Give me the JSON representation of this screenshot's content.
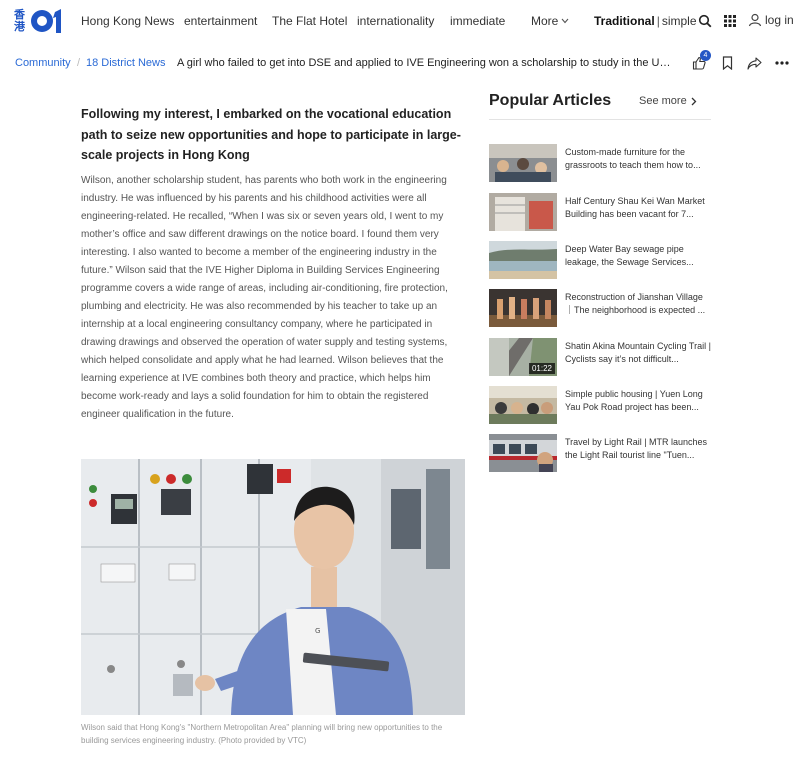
{
  "brand": {
    "cjk_line1": "香",
    "cjk_line2": "港",
    "accent": "#1f55c4"
  },
  "nav": {
    "items": [
      "Hong Kong News",
      "entertainment",
      "The Flat Hotel",
      "internationality",
      "immediate"
    ],
    "more_label": "More",
    "lang_active": "Traditional",
    "lang_sep": "|",
    "lang_alt": "simple",
    "login_label": "log in",
    "icons": [
      "search-icon",
      "grid-icon",
      "user-icon",
      "chevron-down-icon"
    ]
  },
  "breadcrumb": {
    "items": [
      "Community",
      "18 District News"
    ],
    "separator": "/",
    "headline": "A girl who failed to get into DSE and applied to IVE Engineering won a scholarship to study in the UK:...",
    "like_count": "4",
    "icons": [
      "like-icon",
      "bookmark-icon",
      "share-icon",
      "more-icon"
    ]
  },
  "article": {
    "subheading": "Following my interest, I embarked on the vocational education path to seize new opportunities and hope to participate in large-scale projects in Hong Kong",
    "body": "Wilson, another scholarship student, has parents who both work in the engineering industry. He was influenced by his parents and his childhood activities were all engineering-related. He recalled, “When I was six or seven years old, I went to my mother’s office and saw different drawings on the notice board. I found them very interesting. I also wanted to become a member of the engineering industry in the future.” Wilson said that the IVE Higher Diploma in Building Services Engineering programme covers a wide range of areas, including air-conditioning, fire protection, plumbing and electricity. He was also recommended by his teacher to take up an internship at a local engineering consultancy company, where he participated in drawing drawings and observed the operation of water supply and testing systems, which helped consolidate and apply what he had learned. Wilson believes that the learning experience at IVE combines both theory and practice, which helps him become work-ready and lays a solid foundation for him to obtain the registered engineer qualification in the future.",
    "photo_caption": "Wilson said that Hong Kong's \"Northern Metropolitan Area\" planning will bring new opportunities to the building services engineering industry. (Photo provided by VTC)"
  },
  "popular": {
    "title": "Popular Articles",
    "see_more": "See more",
    "items": [
      {
        "text": "Custom-made furniture for the grassroots to teach them how to..."
      },
      {
        "text": "Half Century Shau Kei Wan Market Building has been vacant for 7..."
      },
      {
        "text": "Deep Water Bay sewage pipe leakage, the Sewage Services..."
      },
      {
        "text": "Reconstruction of Jianshan Village ｜The neighborhood is expected ..."
      },
      {
        "text": "Shatin Akina Mountain Cycling Trail | Cyclists say it’s not difficult...",
        "duration": "01:22"
      },
      {
        "text": "Simple public housing | Yuen Long Yau Pok Road project has been..."
      },
      {
        "text": "Travel by Light Rail | MTR launches the Light Rail tourist line \"Tuen..."
      }
    ]
  }
}
